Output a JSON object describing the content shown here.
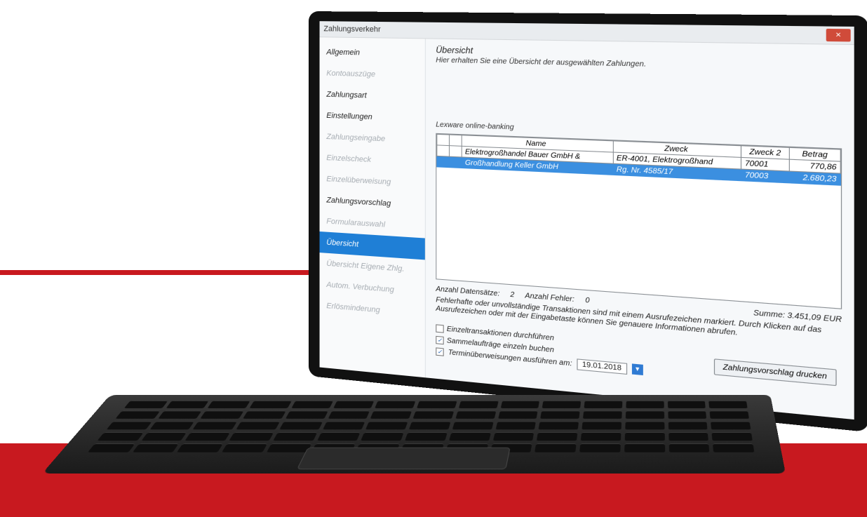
{
  "window": {
    "title": "Zahlungsverkehr",
    "close_label": "×"
  },
  "sidebar": {
    "items": [
      {
        "label": "Allgemein",
        "state": "normal"
      },
      {
        "label": "Kontoauszüge",
        "state": "disabled"
      },
      {
        "label": "Zahlungsart",
        "state": "normal"
      },
      {
        "label": "Einstellungen",
        "state": "normal"
      },
      {
        "label": "Zahlungseingabe",
        "state": "disabled"
      },
      {
        "label": "Einzelscheck",
        "state": "disabled"
      },
      {
        "label": "Einzelüberweisung",
        "state": "disabled"
      },
      {
        "label": "Zahlungsvorschlag",
        "state": "normal"
      },
      {
        "label": "Formularauswahl",
        "state": "disabled"
      },
      {
        "label": "Übersicht",
        "state": "active"
      },
      {
        "label": "Übersicht Eigene Zhlg.",
        "state": "disabled"
      },
      {
        "label": "Autom. Verbuchung",
        "state": "disabled"
      },
      {
        "label": "Erlösminderung",
        "state": "disabled"
      }
    ]
  },
  "main": {
    "title": "Übersicht",
    "subtitle": "Hier erhalten Sie eine Übersicht der ausgewählten Zahlungen.",
    "section_label": "Lexware online-banking"
  },
  "table": {
    "columns": [
      "Name",
      "Zweck",
      "Zweck 2",
      "Betrag"
    ],
    "rows": [
      {
        "name": "Elektrogroßhandel Bauer GmbH &",
        "zweck": "ER-4001, Elektrogroßhand",
        "zweck2": "70001",
        "betrag": "770,86",
        "selected": false
      },
      {
        "name": "Großhandlung Keller GmbH",
        "zweck": "Rg. Nr. 4585/17",
        "zweck2": "70003",
        "betrag": "2.680,23",
        "selected": true
      }
    ]
  },
  "stats": {
    "records_label": "Anzahl Datensätze:",
    "records_value": "2",
    "errors_label": "Anzahl Fehler:",
    "errors_value": "0",
    "sum": "Summe: 3.451,09 EUR"
  },
  "note": "Fehlerhafte oder unvollständige Transaktionen sind mit einem Ausrufezeichen markiert. Durch Klicken auf das Ausrufezeichen oder mit der Eingabetaste können Sie genauere Informationen abrufen.",
  "options": {
    "einzel": {
      "label": "Einzeltransaktionen durchführen",
      "checked": false
    },
    "sammel": {
      "label": "Sammelaufträge einzeln buchen",
      "checked": true
    },
    "termin": {
      "label": "Terminüberweisungen ausführen am:",
      "checked": true
    }
  },
  "date_value": "19.01.2018",
  "print_button": "Zahlungsvorschlag drucken",
  "colors": {
    "brand_red": "#c8191f",
    "selection_blue": "#1f7fd6"
  }
}
